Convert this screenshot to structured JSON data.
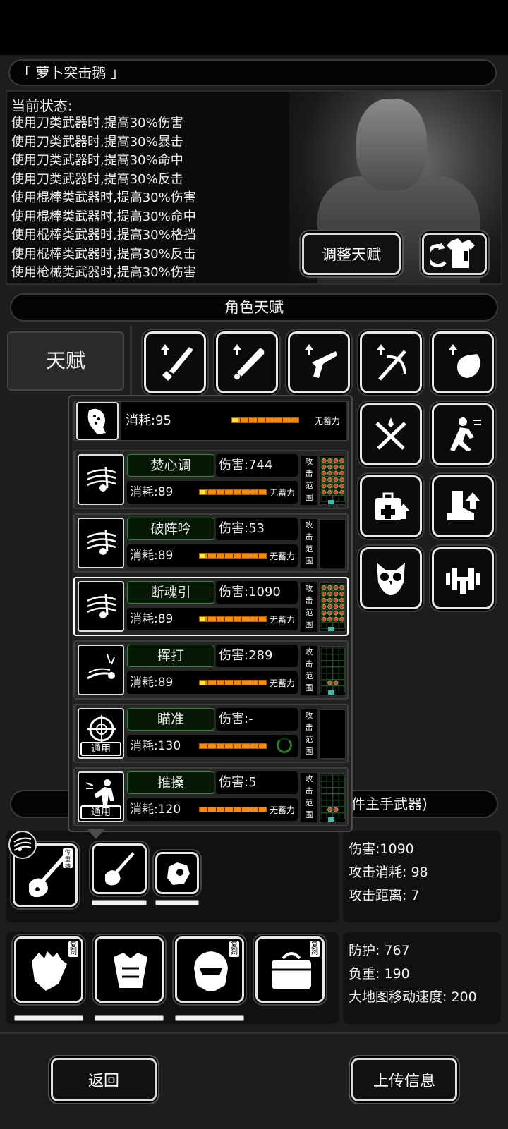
{
  "character": {
    "name": "「 萝卜突击鹅 」",
    "status_title": "当前状态:",
    "status_lines": [
      "使用刀类武器时,提高30%伤害",
      "使用刀类武器时,提高30%暴击",
      "使用刀类武器时,提高30%命中",
      "使用刀类武器时,提高30%反击",
      "使用棍棒类武器时,提高30%伤害",
      "使用棍棒类武器时,提高30%命中",
      "使用棍棒类武器时,提高30%格挡",
      "使用棍棒类武器时,提高30%反击",
      "使用枪械类武器时,提高30%伤害"
    ],
    "adjust_talent_label": "调整天赋"
  },
  "talent_section": {
    "title": "角色天赋",
    "tab_label": "天赋"
  },
  "skill_icons": [
    "sword-up-icon",
    "bat-up-icon",
    "gun-up-icon",
    "crossbow-up-icon",
    "fist-up-icon",
    "crossed-swords-icon",
    "running-man-icon",
    "medkit-up-icon",
    "boot-up-icon",
    "owl-icon",
    "dumbbell-icon"
  ],
  "popup": {
    "first": {
      "cost": "消耗:95",
      "charge": "无蓄力",
      "fill": 0.08
    },
    "skills": [
      {
        "name": "焚心调",
        "damage": "伤害:744",
        "cost": "消耗:89",
        "charge": "无蓄力",
        "fill": 0.08,
        "badge": "",
        "icon": "music-icon",
        "range": "full"
      },
      {
        "name": "破阵吟",
        "damage": "伤害:53",
        "cost": "消耗:89",
        "charge": "无蓄力",
        "fill": 0.08,
        "badge": "",
        "icon": "music-icon",
        "range": "empty"
      },
      {
        "name": "断魂引",
        "damage": "伤害:1090",
        "cost": "消耗:89",
        "charge": "无蓄力",
        "fill": 0.08,
        "badge": "",
        "icon": "music-icon",
        "range": "full"
      },
      {
        "name": "挥打",
        "damage": "伤害:289",
        "cost": "消耗:89",
        "charge": "无蓄力",
        "fill": 0.08,
        "badge": "",
        "icon": "swing-icon",
        "range": "line"
      },
      {
        "name": "瞄准",
        "damage": "伤害:-",
        "cost": "消耗:130",
        "charge": "",
        "fill": 0,
        "badge": "通用",
        "icon": "crosshair-icon",
        "range": "empty"
      },
      {
        "name": "推搡",
        "damage": "伤害:5",
        "cost": "消耗:120",
        "charge": "无蓄力",
        "fill": 0,
        "badge": "通用",
        "icon": "push-icon",
        "range": "line"
      }
    ],
    "range_label": [
      "攻",
      "击",
      "范",
      "围"
    ]
  },
  "equipment": {
    "bar_title": "件主手武器)",
    "weapon_stats": [
      "伤害:1090",
      "攻击消耗: 98",
      "攻击距离: 7"
    ],
    "armor_stats": [
      "防护: 767",
      "负重: 190",
      "大地图移动速度: 200"
    ],
    "tag_forge": "传重铸",
    "tag_copy": "复刻"
  },
  "buttons": {
    "back": "返回",
    "upload": "上传信息"
  }
}
